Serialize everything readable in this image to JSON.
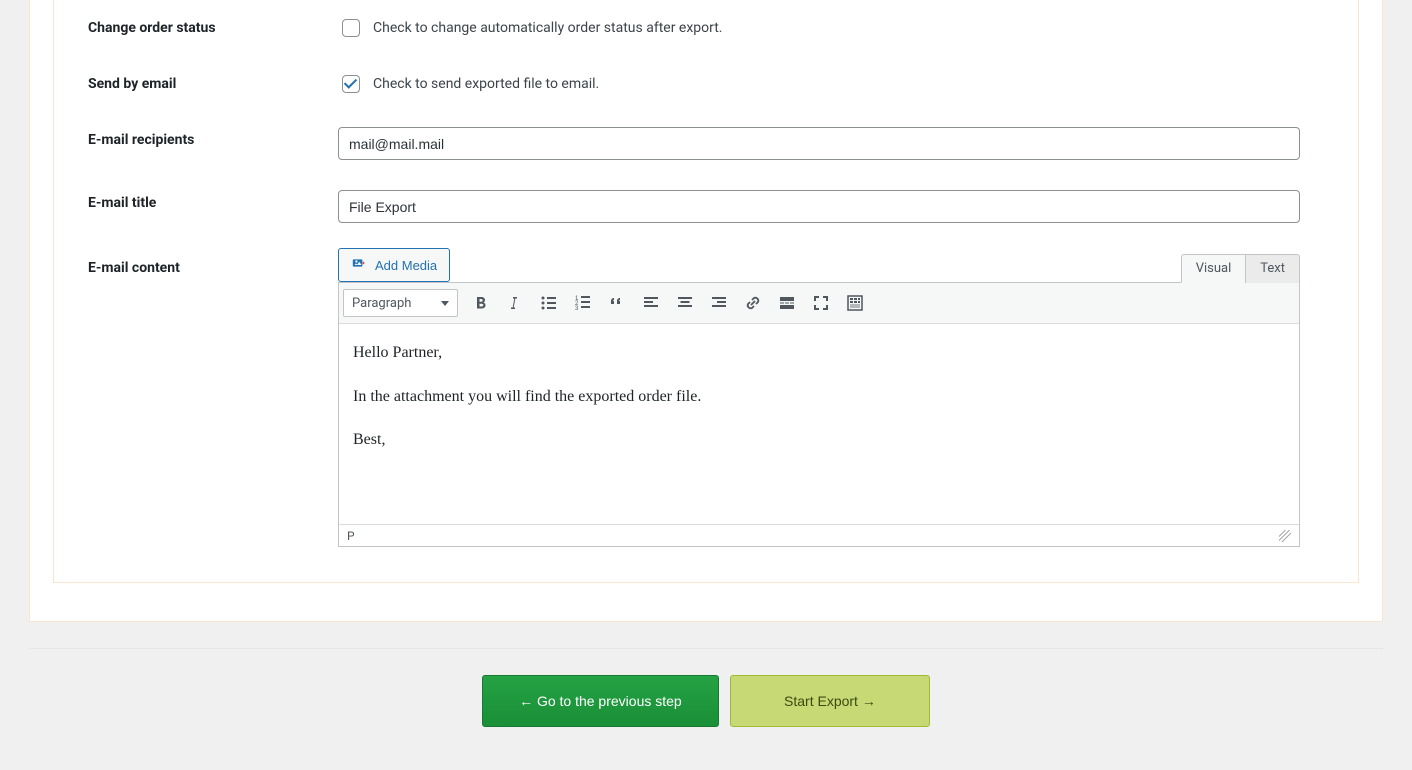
{
  "form": {
    "change_order_status": {
      "label": "Change order status",
      "checkbox_label": "Check to change automatically order status after export.",
      "checked": false
    },
    "send_by_email": {
      "label": "Send by email",
      "checkbox_label": "Check to send exported file to email.",
      "checked": true
    },
    "email_recipients": {
      "label": "E-mail recipients",
      "value": "mail@mail.mail"
    },
    "email_title": {
      "label": "E-mail title",
      "value": "File Export"
    },
    "email_content": {
      "label": "E-mail content"
    }
  },
  "editor": {
    "add_media": "Add Media",
    "tab_visual": "Visual",
    "tab_text": "Text",
    "format_select": "Paragraph",
    "body": {
      "p1": "Hello Partner,",
      "p2": "In the attachment you will find the exported order file.",
      "p3": "Best,"
    },
    "status_path": "P"
  },
  "buttons": {
    "prev": "← Go to the previous step",
    "start": "Start Export →"
  }
}
